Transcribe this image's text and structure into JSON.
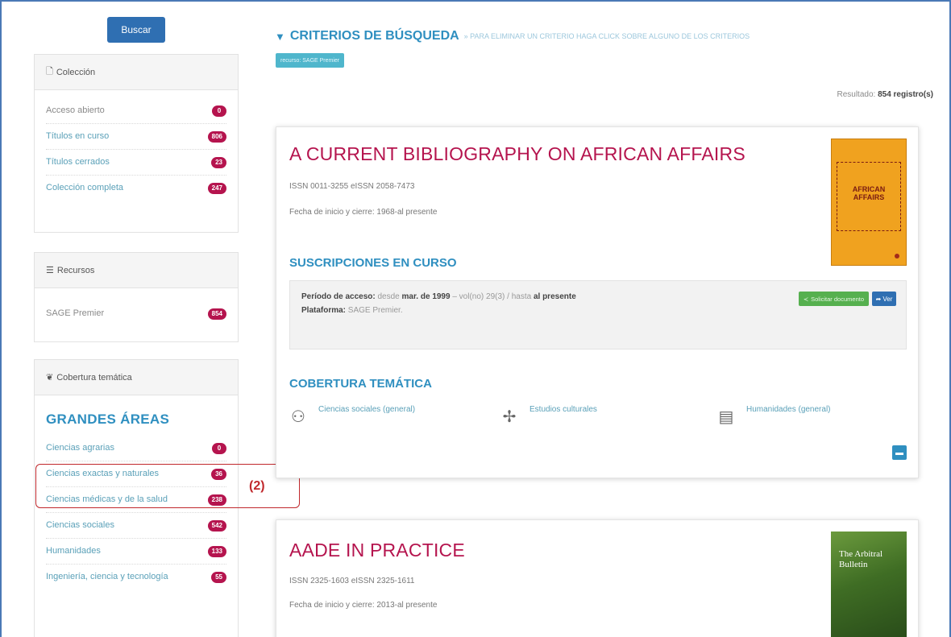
{
  "sidebar": {
    "search_button": "Buscar",
    "coleccion": {
      "title": "Colección",
      "items": [
        {
          "label": "Acceso abierto",
          "count": "0",
          "style": "gray"
        },
        {
          "label": "Títulos en curso",
          "count": "806",
          "style": "link"
        },
        {
          "label": "Títulos cerrados",
          "count": "23",
          "style": "link"
        },
        {
          "label": "Colección completa",
          "count": "247",
          "style": "link"
        }
      ]
    },
    "recursos": {
      "title": "Recursos",
      "items": [
        {
          "label": "SAGE Premier",
          "count": "854",
          "style": "gray"
        }
      ]
    },
    "cobertura": {
      "title": "Cobertura temática",
      "heading": "GRANDES ÁREAS",
      "items": [
        {
          "label": "Ciencias agrarias",
          "count": "0"
        },
        {
          "label": "Ciencias exactas y naturales",
          "count": "36"
        },
        {
          "label": "Ciencias médicas y de la salud",
          "count": "238"
        },
        {
          "label": "Ciencias sociales",
          "count": "542"
        },
        {
          "label": "Humanidades",
          "count": "133"
        },
        {
          "label": "Ingeniería, ciencia y tecnología",
          "count": "55"
        }
      ]
    }
  },
  "annotation": {
    "label": "(2)",
    "color": "#c0282c"
  },
  "main": {
    "criteria_title": "CRITERIOS DE BÚSQUEDA",
    "criteria_hint": "» PARA ELIMINAR UN CRITERIO HAGA CLICK SOBRE ALGUNO DE LOS CRITERIOS",
    "criteria_tag": "recurso: SAGE Premier",
    "results_label": "Resultado:",
    "results_value": "854 registro(s)",
    "cards": [
      {
        "title": "A CURRENT BIBLIOGRAPHY ON AFRICAN AFFAIRS",
        "issn": "ISSN 0011-3255    eISSN 2058-7473",
        "dates": "Fecha de inicio y cierre: 1968-al presente",
        "cover_text": "AFRICAN AFFAIRS",
        "subscriptions_title": "SUSCRIPCIONES EN CURSO",
        "access_label": "Período de acceso:",
        "access_from": "desde",
        "access_from_date": "mar. de 1999",
        "access_volume": "– vol(no) 29(3) / hasta",
        "access_to": "al presente",
        "platform_label": "Plataforma:",
        "platform_value": "SAGE Premier.",
        "request_button": "Solicitar documento",
        "view_button": "Ver",
        "coverage_title": "COBERTURA TEMÁTICA",
        "topics": [
          "Ciencias sociales (general)",
          "Estudios culturales",
          "Humanidades (general)"
        ]
      },
      {
        "title": "AADE IN PRACTICE",
        "issn": "ISSN 2325-1603    eISSN 2325-1611",
        "dates": "Fecha de inicio y cierre: 2013-al presente",
        "cover_text": "The Arbitral Bulletin"
      }
    ]
  },
  "colors": {
    "primary": "#2f6fb2",
    "accent": "#2f8fc0",
    "title": "#b5144e",
    "badge": "#b5144e",
    "success": "#56b04f"
  }
}
